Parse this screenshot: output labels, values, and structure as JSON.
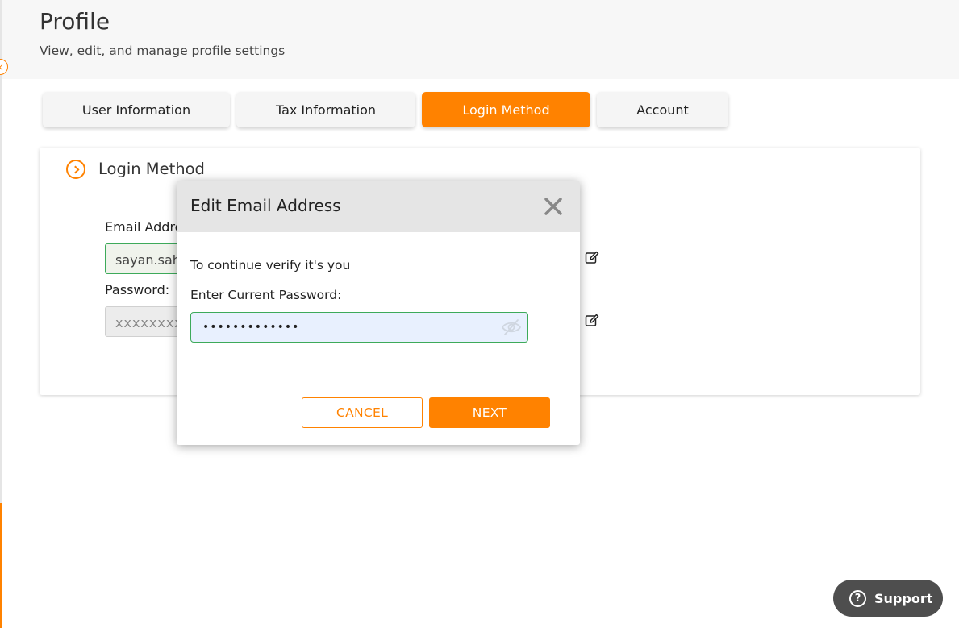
{
  "header": {
    "title": "Profile",
    "subtitle": "View, edit, and manage profile settings"
  },
  "tabs": [
    {
      "label": "User Information",
      "active": false
    },
    {
      "label": "Tax Information",
      "active": false
    },
    {
      "label": "Login Method",
      "active": true
    },
    {
      "label": "Account",
      "active": false
    }
  ],
  "panel": {
    "title": "Login Method",
    "email_label": "Email Address:",
    "email_value": "sayan.saha",
    "password_label": "Password:",
    "password_value": "xxxxxxxxxx"
  },
  "modal": {
    "title": "Edit Email Address",
    "prompt": "To continue verify it's you",
    "password_label": "Enter Current Password:",
    "password_value": "•••••••••••••",
    "cancel_label": "CANCEL",
    "next_label": "NEXT"
  },
  "support": {
    "icon_glyph": "?",
    "label": "Support"
  },
  "colors": {
    "accent": "#ff8200",
    "valid_border": "#3daa5a",
    "support_bg": "#4e4e4e"
  },
  "icons": {
    "collapse": "chevron-left-icon",
    "section": "chevron-right-circle-icon",
    "edit": "edit-pencil-icon",
    "close": "close-icon",
    "visibility": "eye-slash-icon",
    "support": "question-circle-icon"
  }
}
